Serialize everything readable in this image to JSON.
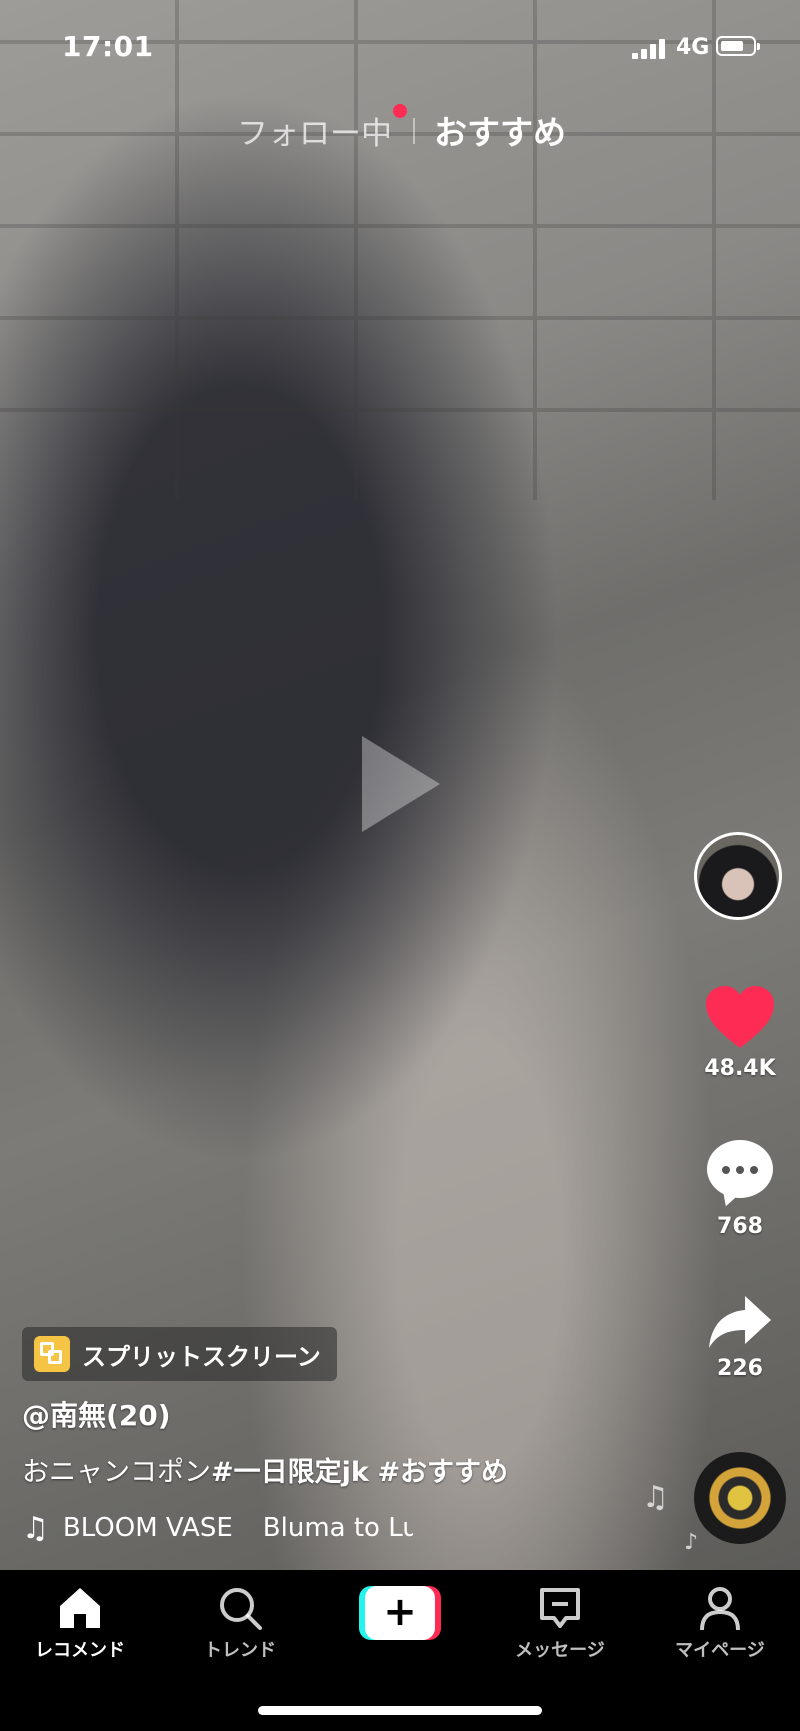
{
  "status_bar": {
    "time": "17:01",
    "network": "4G"
  },
  "feed_tabs": {
    "following": "フォロー中",
    "for_you": "おすすめ"
  },
  "actions": {
    "likes": "48.4K",
    "comments": "768",
    "shares": "226"
  },
  "video_info": {
    "effect_chip": "スプリットスクリーン",
    "username": "@南無(20)",
    "caption_text": "おニャンコポン",
    "hashtags": [
      "#一日限定jk",
      "#おすすめ"
    ],
    "music_segments": [
      "BLOOM VASE",
      "Bluma to Lu"
    ]
  },
  "nav": {
    "home": "レコメンド",
    "trend": "トレンド",
    "messages": "メッセージ",
    "profile": "マイページ",
    "create": "+"
  },
  "colors": {
    "accent_red": "#fe2c55",
    "accent_cyan": "#25f4ee",
    "effect_yellow": "#f6c445"
  }
}
